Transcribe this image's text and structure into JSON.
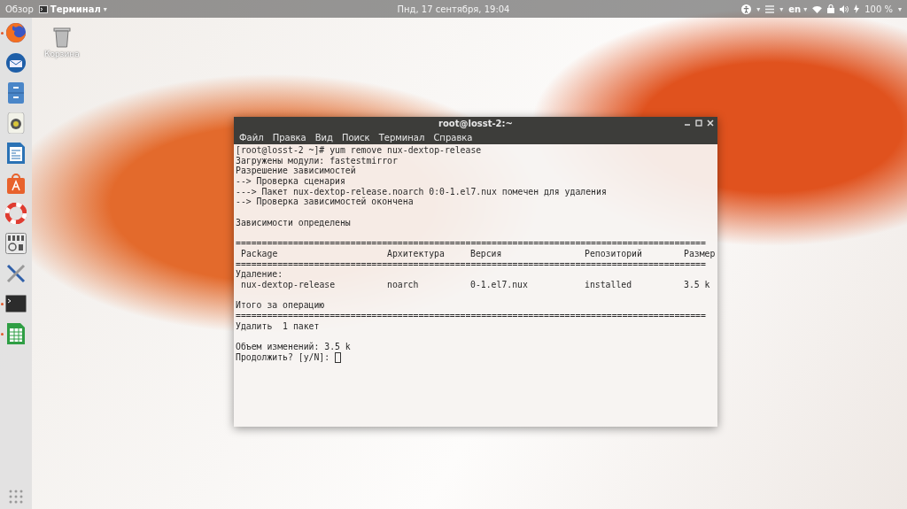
{
  "top_bar": {
    "activities": "Обзор",
    "app_menu": {
      "label": "Терминал",
      "caret": "▾"
    },
    "clock": "Пнд, 17 сентября, 19:04",
    "accessibility_caret": "▾",
    "menu_caret": "▾",
    "language": {
      "label": "en",
      "caret": "▾"
    },
    "battery": "100 %",
    "system_caret": "▾"
  },
  "dock": [
    {
      "kind": "browser",
      "running": true
    },
    {
      "kind": "mail",
      "running": false
    },
    {
      "kind": "files",
      "running": false
    },
    {
      "kind": "speaker",
      "running": false
    },
    {
      "kind": "writer",
      "running": false
    },
    {
      "kind": "store",
      "running": false
    },
    {
      "kind": "help",
      "running": false
    },
    {
      "kind": "settings",
      "running": false
    },
    {
      "kind": "tools",
      "running": false
    },
    {
      "kind": "terminal",
      "running": true
    },
    {
      "kind": "calc",
      "running": true
    }
  ],
  "desktop_icons": [
    {
      "label": "Корзина"
    }
  ],
  "terminal": {
    "title": "root@losst-2:~",
    "menu": [
      "Файл",
      "Правка",
      "Вид",
      "Поиск",
      "Терминал",
      "Справка"
    ],
    "lines": [
      {
        "kind": "text",
        "text": "[root@losst-2 ~]# yum remove nux-dextop-release"
      },
      {
        "kind": "text",
        "text": "Загружены модули: fastestmirror"
      },
      {
        "kind": "text",
        "text": "Разрешение зависимостей"
      },
      {
        "kind": "text",
        "text": "--> Проверка сценария"
      },
      {
        "kind": "text",
        "text": "---> Пакет nux-dextop-release.noarch 0:0-1.el7.nux помечен для удаления"
      },
      {
        "kind": "text",
        "text": "--> Проверка зависимостей окончена"
      },
      {
        "kind": "blank"
      },
      {
        "kind": "text",
        "text": "Зависимости определены"
      },
      {
        "kind": "blank"
      },
      {
        "kind": "rule",
        "text": "=========================================================================================="
      },
      {
        "kind": "row",
        "cells": [
          "Package",
          "Архитектура",
          "Версия",
          "Репозиторий",
          "Размер"
        ]
      },
      {
        "kind": "rule",
        "text": "=========================================================================================="
      },
      {
        "kind": "text",
        "text": "Удаление:"
      },
      {
        "kind": "row",
        "cells": [
          "nux-dextop-release",
          "noarch",
          "0-1.el7.nux",
          "installed",
          "3.5 k"
        ]
      },
      {
        "kind": "blank"
      },
      {
        "kind": "text",
        "text": "Итого за операцию"
      },
      {
        "kind": "rule",
        "text": "=========================================================================================="
      },
      {
        "kind": "text",
        "text": "Удалить  1 пакет"
      },
      {
        "kind": "blank"
      },
      {
        "kind": "text",
        "text": "Объем изменений: 3.5 k"
      },
      {
        "kind": "prompt",
        "text": "Продолжить? [y/N]:"
      }
    ]
  }
}
